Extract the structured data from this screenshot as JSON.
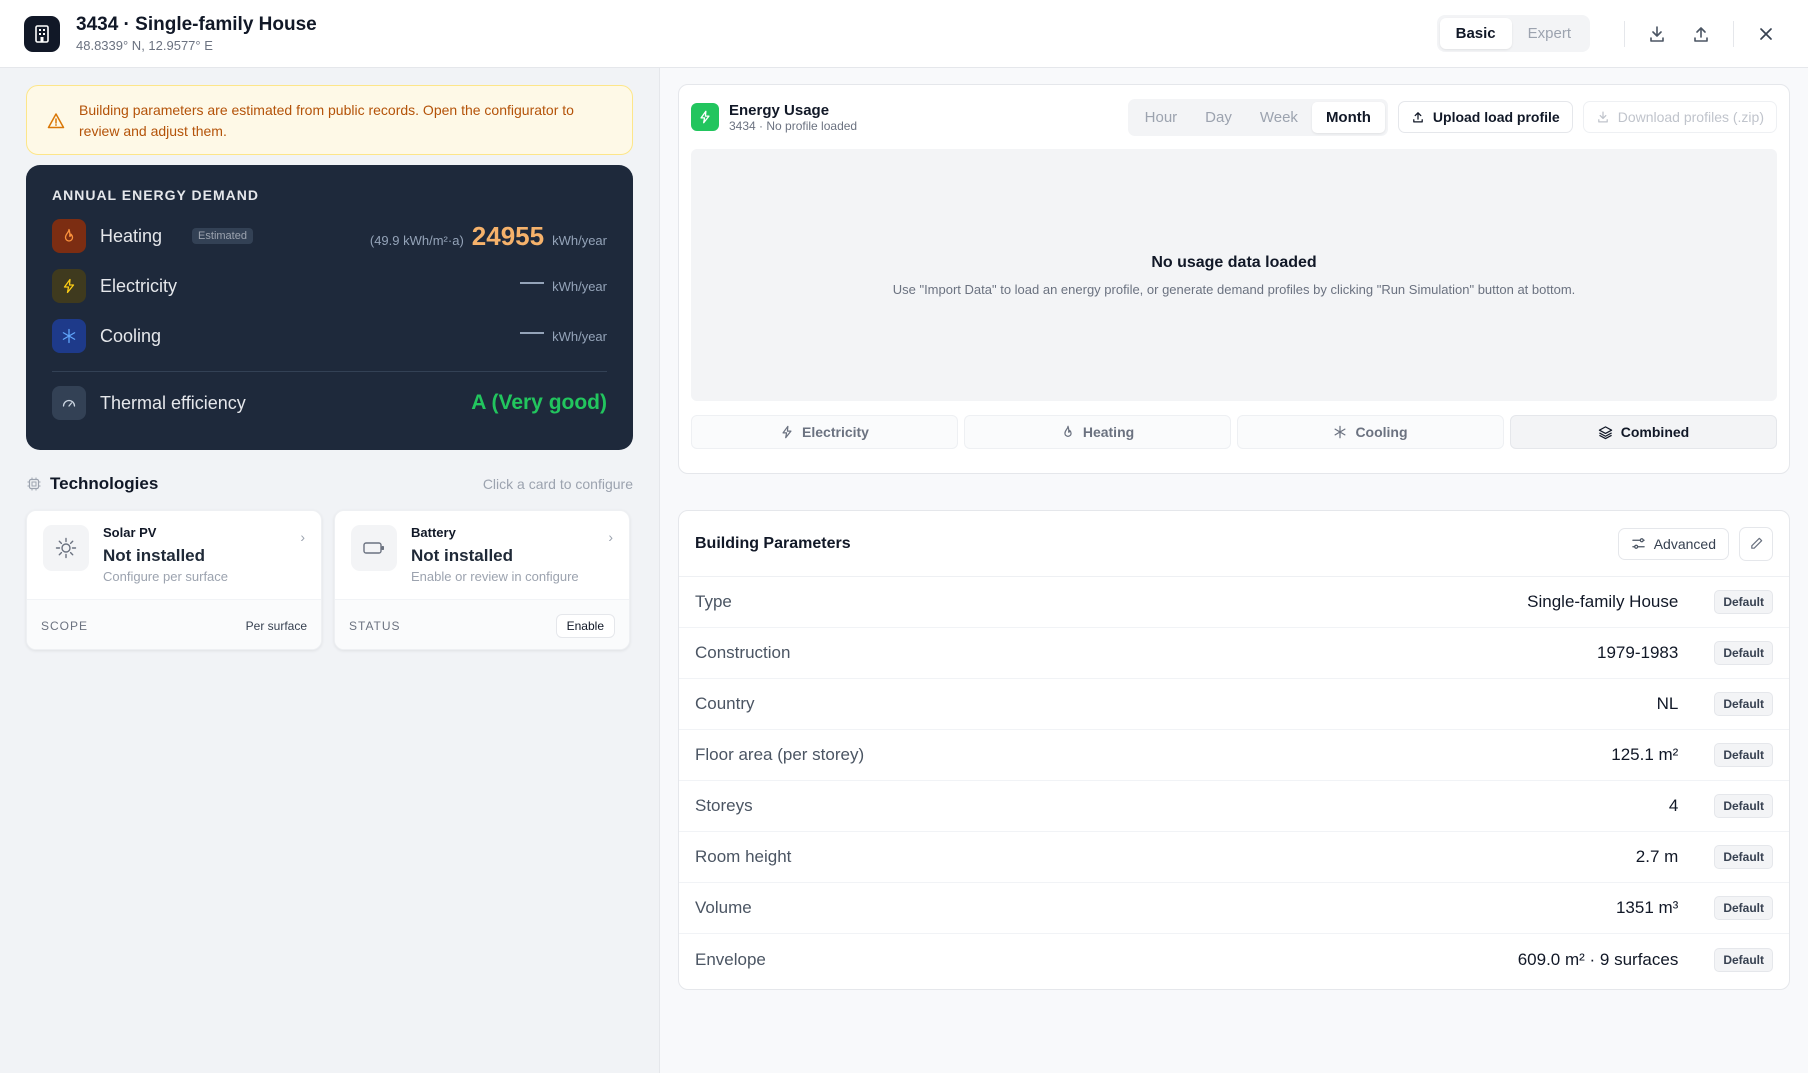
{
  "header": {
    "title": "3434 · Single-family House",
    "coords": "48.8339° N, 12.9577° E",
    "modes": [
      "Basic",
      "Expert"
    ]
  },
  "warning": {
    "text": "Building parameters are estimated from public records. Open the configurator to review and adjust them."
  },
  "demand": {
    "title": "ANNUAL ENERGY DEMAND",
    "heating": {
      "label": "Heating",
      "tag": "Estimated",
      "intensity": "(49.9 kWh/m²·a)",
      "value": "24955",
      "unit": "kWh/year"
    },
    "electricity": {
      "label": "Electricity",
      "unit": "kWh/year"
    },
    "cooling": {
      "label": "Cooling",
      "unit": "kWh/year"
    },
    "efficiency": {
      "label": "Thermal efficiency",
      "value": "A (Very good)"
    }
  },
  "technologies": {
    "title": "Technologies",
    "hint": "Click a card to configure",
    "solar": {
      "name": "Solar PV",
      "state": "Not installed",
      "sub": "Configure per surface",
      "key": "SCOPE",
      "val": "Per surface"
    },
    "battery": {
      "name": "Battery",
      "state": "Not installed",
      "sub": "Enable or review in configure",
      "key": "STATUS",
      "action": "Enable"
    }
  },
  "energy_usage": {
    "title": "Energy Usage",
    "subtitle": "3434 · No profile loaded",
    "periods": [
      "Hour",
      "Day",
      "Week",
      "Month"
    ],
    "upload": "Upload load profile",
    "download": "Download profiles (.zip)",
    "empty_title": "No usage data loaded",
    "empty_text": "Use \"Import Data\" to load an energy profile, or generate demand profiles by clicking \"Run Simulation\" button at bottom.",
    "tabs": [
      "Electricity",
      "Heating",
      "Cooling",
      "Combined"
    ]
  },
  "building": {
    "title": "Building Parameters",
    "advanced": "Advanced",
    "badge": "Default",
    "rows": [
      {
        "label": "Type",
        "value": "Single-family House"
      },
      {
        "label": "Construction",
        "value": "1979-1983"
      },
      {
        "label": "Country",
        "value": "NL"
      },
      {
        "label": "Floor area (per storey)",
        "value": "125.1 m²"
      },
      {
        "label": "Storeys",
        "value": "4"
      },
      {
        "label": "Room height",
        "value": "2.7 m"
      },
      {
        "label": "Volume",
        "value": "1351 m³"
      },
      {
        "label": "Envelope",
        "value": "609.0 m² · 9 surfaces"
      }
    ]
  },
  "colors": {
    "accent_green": "#22c55e",
    "heating_orange": "#f6b26b",
    "dark_panel": "#1e293b",
    "warning_text": "#b45309"
  }
}
